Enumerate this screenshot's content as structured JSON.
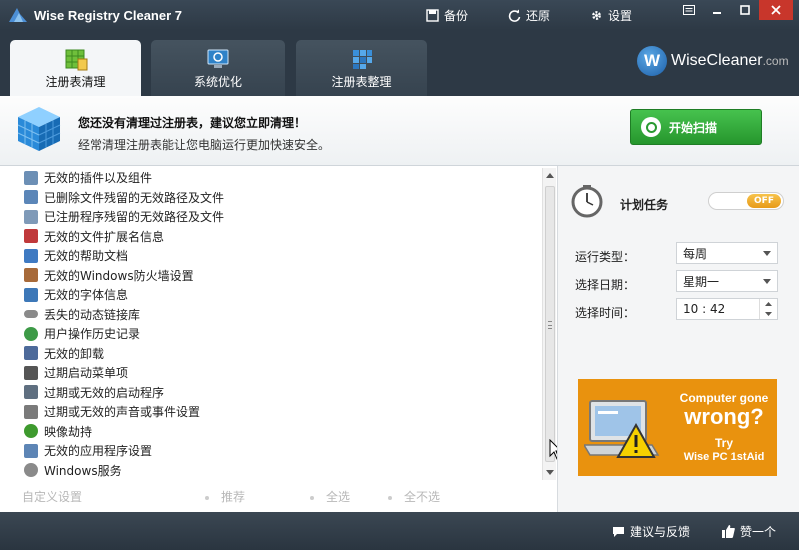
{
  "titlebar": {
    "app_title": "Wise Registry Cleaner 7",
    "backup_label": "备份",
    "restore_label": "还原",
    "settings_label": "设置",
    "window_controls": [
      "menu-icon",
      "minimize-icon",
      "maximize-icon",
      "close-icon"
    ]
  },
  "tabs": [
    {
      "label": "注册表清理",
      "icon": "registry-clean-icon",
      "active": true
    },
    {
      "label": "系统优化",
      "icon": "system-optimize-icon",
      "active": false
    },
    {
      "label": "注册表整理",
      "icon": "registry-defrag-icon",
      "active": false
    }
  ],
  "brand": {
    "logo_letter": "W",
    "name": "WiseCleaner",
    "suffix": ".com"
  },
  "banner": {
    "title": "您还没有清理过注册表，建议您立即清理！",
    "subtitle": "经常清理注册表能让您电脑运行更加快速安全。",
    "scan_button": "开始扫描"
  },
  "items": [
    {
      "label": "无效的插件以及组件",
      "icon": "plugin-icon",
      "color": "#6c8fb5"
    },
    {
      "label": "已删除文件残留的无效路径及文件",
      "icon": "deleted-file-icon",
      "color": "#5b86b8"
    },
    {
      "label": "已注册程序残留的无效路径及文件",
      "icon": "program-file-icon",
      "color": "#7f9ab8"
    },
    {
      "label": "无效的文件扩展名信息",
      "icon": "file-extension-icon",
      "color": "#c0393b"
    },
    {
      "label": "无效的帮助文档",
      "icon": "help-document-icon",
      "color": "#3f7ac2"
    },
    {
      "label": "无效的Windows防火墙设置",
      "icon": "firewall-icon",
      "color": "#a76a3a"
    },
    {
      "label": "无效的字体信息",
      "icon": "font-icon",
      "color": "#3d78b8"
    },
    {
      "label": "丢失的动态链接库",
      "icon": "dll-icon",
      "color": "#8a8a8a"
    },
    {
      "label": "用户操作历史记录",
      "icon": "history-icon",
      "color": "#3d9a47"
    },
    {
      "label": "无效的卸载",
      "icon": "uninstall-icon",
      "color": "#4d6a9a"
    },
    {
      "label": "过期启动菜单项",
      "icon": "startup-menu-icon",
      "color": "#555555"
    },
    {
      "label": "过期或无效的启动程序",
      "icon": "startup-program-icon",
      "color": "#5f6f80"
    },
    {
      "label": "过期或无效的声音或事件设置",
      "icon": "sound-icon",
      "color": "#7a7a7a"
    },
    {
      "label": "映像劫持",
      "icon": "bug-icon",
      "color": "#3e9a2e"
    },
    {
      "label": "无效的应用程序设置",
      "icon": "app-settings-icon",
      "color": "#5d85b5"
    },
    {
      "label": "Windows服务",
      "icon": "services-icon",
      "color": "#8a8a8a"
    }
  ],
  "actions": {
    "custom": "自定义设置",
    "recommended": "推荐",
    "select_all": "全选",
    "select_none": "全不选"
  },
  "schedule": {
    "label": "计划任务",
    "toggle_state": "OFF",
    "run_type_label": "运行类型：",
    "run_type_value": "每周",
    "day_label": "选择日期：",
    "day_value": "星期一",
    "time_label": "选择时间：",
    "time_value": "10 : 42"
  },
  "ad": {
    "line1": "Computer gone",
    "line2": "wrong?",
    "line3": "Try",
    "line4": "Wise PC 1stAid"
  },
  "footer": {
    "feedback": "建议与反馈",
    "like": "赞一个"
  },
  "colors": {
    "titlebar": "#2d3945",
    "scan_button": "#2fa838",
    "toggle_knob": "#f0a928",
    "ad_background": "#e9920e"
  }
}
